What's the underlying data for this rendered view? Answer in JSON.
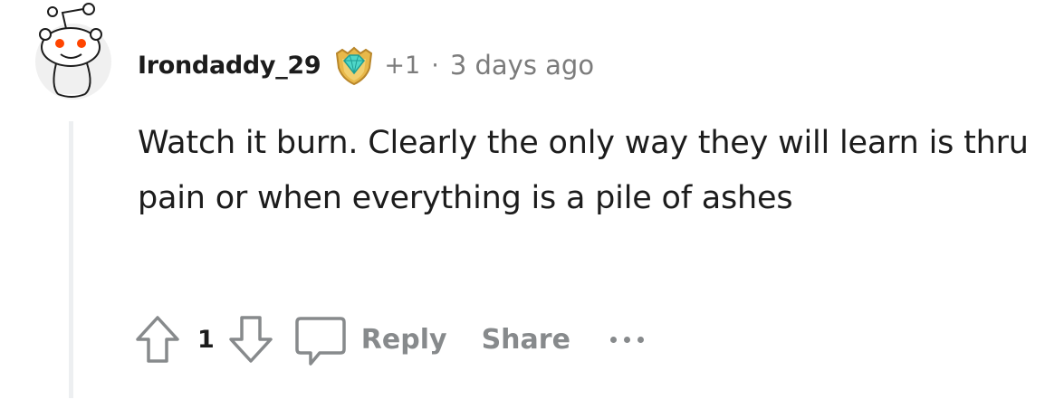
{
  "comment": {
    "username": "Irondaddy_29",
    "award_count": "+1",
    "separator": "·",
    "timestamp": "3 days ago",
    "body": "Watch it burn. Clearly the only way they will learn is thru pain or when everything is a pile of ashes",
    "avatar_icon": "snoo-avatar-icon",
    "award_icon": "diamond-award-icon"
  },
  "actions": {
    "upvote_icon": "arrow-up-icon",
    "score": "1",
    "downvote_icon": "arrow-down-icon",
    "comment_icon": "speech-bubble-icon",
    "reply_label": "Reply",
    "share_label": "Share",
    "more_icon": "ellipsis-icon"
  },
  "colors": {
    "text": "#1c1c1c",
    "meta": "#7c7c7c",
    "action": "#878a8c",
    "thread_line": "#edeff1",
    "avatar_eye": "#ff4500"
  }
}
